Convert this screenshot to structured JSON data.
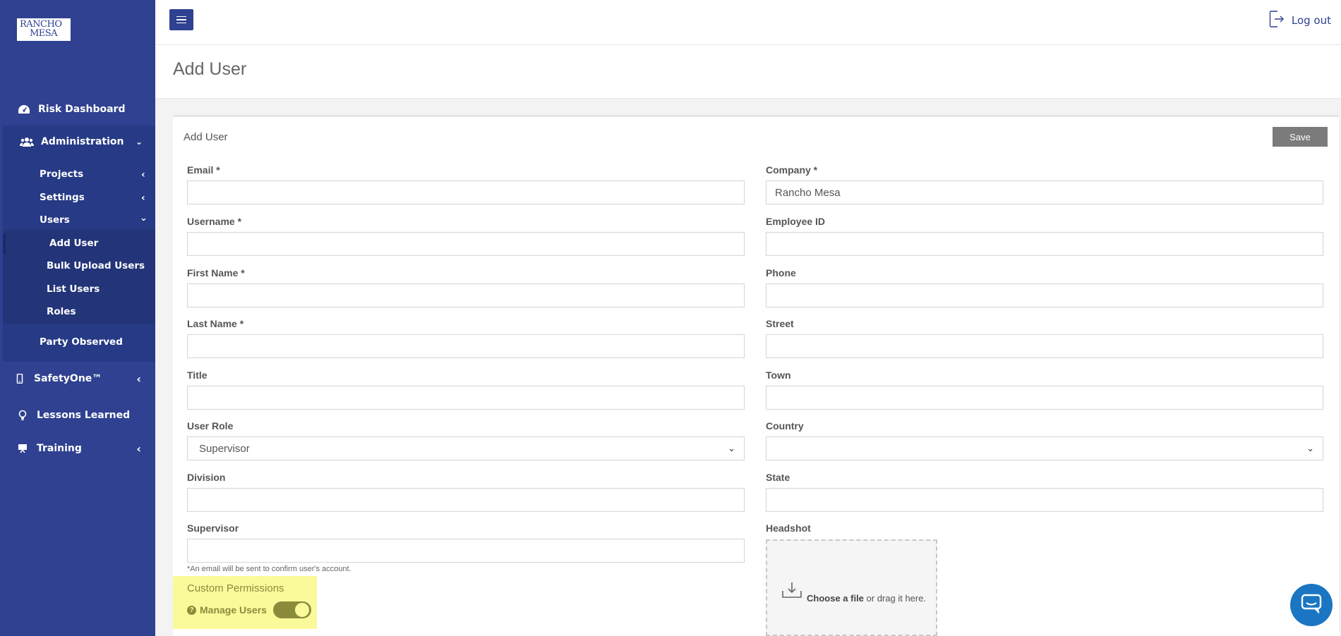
{
  "brand": {
    "logo_line1": "RANCHO",
    "logo_line2": "MESA"
  },
  "header": {
    "logout_label": "Log out"
  },
  "page": {
    "title": "Add User"
  },
  "sidebar": {
    "items": [
      {
        "label": "Risk Dashboard",
        "icon": "dashboard-icon"
      },
      {
        "label": "Administration",
        "icon": "users-group-icon"
      },
      {
        "label": "SafetyOne™",
        "icon": "mobile-icon"
      },
      {
        "label": "Lessons Learned",
        "icon": "lightbulb-icon"
      },
      {
        "label": "Training",
        "icon": "presentation-icon"
      }
    ],
    "admin_sub": [
      {
        "label": "Projects"
      },
      {
        "label": "Settings"
      },
      {
        "label": "Users"
      },
      {
        "label": "Party Observed"
      }
    ],
    "users_sub": [
      {
        "label": "Add User"
      },
      {
        "label": "Bulk Upload Users"
      },
      {
        "label": "List Users"
      },
      {
        "label": "Roles"
      }
    ]
  },
  "form": {
    "card_title": "Add User",
    "save_label": "Save",
    "left": {
      "email": {
        "label": "Email *",
        "value": ""
      },
      "username": {
        "label": "Username *",
        "value": ""
      },
      "first_name": {
        "label": "First Name *",
        "value": ""
      },
      "last_name": {
        "label": "Last Name *",
        "value": ""
      },
      "title": {
        "label": "Title",
        "value": ""
      },
      "user_role": {
        "label": "User Role",
        "value": "Supervisor"
      },
      "division": {
        "label": "Division",
        "value": ""
      },
      "supervisor": {
        "label": "Supervisor",
        "value": ""
      }
    },
    "right": {
      "company": {
        "label": "Company *",
        "value": "Rancho Mesa"
      },
      "employee_id": {
        "label": "Employee ID",
        "value": ""
      },
      "phone": {
        "label": "Phone",
        "value": ""
      },
      "street": {
        "label": "Street",
        "value": ""
      },
      "town": {
        "label": "Town",
        "value": ""
      },
      "country": {
        "label": "Country",
        "value": ""
      },
      "state": {
        "label": "State",
        "value": ""
      },
      "headshot": {
        "label": "Headshot"
      }
    },
    "hint": "*An email will be sent to confirm user's account.",
    "permissions": {
      "title": "Custom Permissions",
      "manage_users_label": "Manage Users",
      "manage_users_enabled": true
    },
    "dropzone": {
      "choose": "Choose a file",
      "rest": " or drag it here."
    }
  },
  "colors": {
    "sidebar": "#2f4190",
    "highlight": "#fbfa9b",
    "chat": "#1a76c2"
  }
}
